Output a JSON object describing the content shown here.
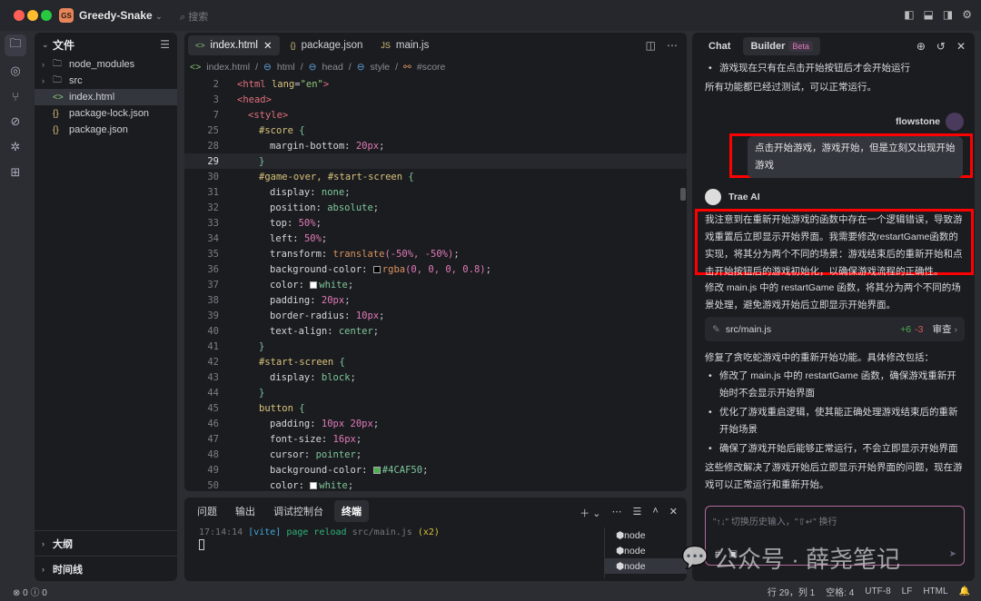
{
  "title_bar": {
    "project_initials": "GS",
    "project_name": "Greedy-Snake",
    "search_placeholder": "搜索"
  },
  "explorer": {
    "title": "文件",
    "items": [
      {
        "label": "node_modules",
        "type": "folder"
      },
      {
        "label": "src",
        "type": "folder"
      },
      {
        "label": "index.html",
        "type": "html",
        "selected": true
      },
      {
        "label": "package-lock.json",
        "type": "json"
      },
      {
        "label": "package.json",
        "type": "json"
      }
    ],
    "outline_label": "大纲",
    "timeline_label": "时间线"
  },
  "editor": {
    "tabs": [
      {
        "label": "index.html",
        "icon": "<>",
        "active": true
      },
      {
        "label": "package.json",
        "icon": "{}"
      },
      {
        "label": "main.js",
        "icon": "JS"
      }
    ],
    "breadcrumb": [
      "index.html",
      "html",
      "head",
      "style",
      "#score"
    ],
    "current_line": 29,
    "lines": [
      {
        "n": "2",
        "i": 0,
        "t": [
          [
            "tag",
            "<html "
          ],
          [
            "attr",
            "lang"
          ],
          [
            "pun",
            "="
          ],
          [
            "str",
            "\"en\""
          ],
          [
            "tag",
            ">"
          ]
        ]
      },
      {
        "n": "3",
        "i": 0,
        "t": [
          [
            "tag",
            "<head>"
          ]
        ]
      },
      {
        "n": "7",
        "i": 1,
        "t": [
          [
            "tag",
            "<style>"
          ]
        ]
      },
      {
        "n": "25",
        "i": 2,
        "t": [
          [
            "sel",
            "#score "
          ],
          [
            "brace",
            "{"
          ]
        ]
      },
      {
        "n": "28",
        "i": 3,
        "t": [
          [
            "prop",
            "margin-bottom: "
          ],
          [
            "num",
            "20px"
          ],
          [
            "pun",
            ";"
          ]
        ]
      },
      {
        "n": "29",
        "i": 2,
        "t": [
          [
            "brace",
            "}"
          ]
        ]
      },
      {
        "n": "30",
        "i": 2,
        "t": [
          [
            "sel",
            "#game-over, #start-screen "
          ],
          [
            "brace",
            "{"
          ]
        ]
      },
      {
        "n": "31",
        "i": 3,
        "t": [
          [
            "prop",
            "display: "
          ],
          [
            "val",
            "none"
          ],
          [
            "pun",
            ";"
          ]
        ]
      },
      {
        "n": "32",
        "i": 3,
        "t": [
          [
            "prop",
            "position: "
          ],
          [
            "val",
            "absolute"
          ],
          [
            "pun",
            ";"
          ]
        ]
      },
      {
        "n": "33",
        "i": 3,
        "t": [
          [
            "prop",
            "top: "
          ],
          [
            "num",
            "50%"
          ],
          [
            "pun",
            ";"
          ]
        ]
      },
      {
        "n": "34",
        "i": 3,
        "t": [
          [
            "prop",
            "left: "
          ],
          [
            "num",
            "50%"
          ],
          [
            "pun",
            ";"
          ]
        ]
      },
      {
        "n": "35",
        "i": 3,
        "t": [
          [
            "prop",
            "transform: "
          ],
          [
            "fn",
            "translate"
          ],
          [
            "num",
            "(-50%, -50%)"
          ],
          [
            "pun",
            ";"
          ]
        ]
      },
      {
        "n": "36",
        "i": 3,
        "t": [
          [
            "prop",
            "background-color: "
          ],
          [
            "sw:#000000",
            ""
          ],
          [
            "fn",
            "rgba"
          ],
          [
            "num",
            "(0, 0, 0, 0.8)"
          ],
          [
            "pun",
            ";"
          ]
        ]
      },
      {
        "n": "37",
        "i": 3,
        "t": [
          [
            "prop",
            "color: "
          ],
          [
            "sw:#ffffff",
            ""
          ],
          [
            "val",
            "white"
          ],
          [
            "pun",
            ";"
          ]
        ]
      },
      {
        "n": "38",
        "i": 3,
        "t": [
          [
            "prop",
            "padding: "
          ],
          [
            "num",
            "20px"
          ],
          [
            "pun",
            ";"
          ]
        ]
      },
      {
        "n": "39",
        "i": 3,
        "t": [
          [
            "prop",
            "border-radius: "
          ],
          [
            "num",
            "10px"
          ],
          [
            "pun",
            ";"
          ]
        ]
      },
      {
        "n": "40",
        "i": 3,
        "t": [
          [
            "prop",
            "text-align: "
          ],
          [
            "val",
            "center"
          ],
          [
            "pun",
            ";"
          ]
        ]
      },
      {
        "n": "41",
        "i": 2,
        "t": [
          [
            "brace",
            "}"
          ]
        ]
      },
      {
        "n": "42",
        "i": 2,
        "t": [
          [
            "sel",
            "#start-screen "
          ],
          [
            "brace",
            "{"
          ]
        ]
      },
      {
        "n": "43",
        "i": 3,
        "t": [
          [
            "prop",
            "display: "
          ],
          [
            "val",
            "block"
          ],
          [
            "pun",
            ";"
          ]
        ]
      },
      {
        "n": "44",
        "i": 2,
        "t": [
          [
            "brace",
            "}"
          ]
        ]
      },
      {
        "n": "45",
        "i": 2,
        "t": [
          [
            "sel",
            "button "
          ],
          [
            "brace",
            "{"
          ]
        ]
      },
      {
        "n": "46",
        "i": 3,
        "t": [
          [
            "prop",
            "padding: "
          ],
          [
            "num",
            "10px 20px"
          ],
          [
            "pun",
            ";"
          ]
        ]
      },
      {
        "n": "47",
        "i": 3,
        "t": [
          [
            "prop",
            "font-size: "
          ],
          [
            "num",
            "16px"
          ],
          [
            "pun",
            ";"
          ]
        ]
      },
      {
        "n": "48",
        "i": 3,
        "t": [
          [
            "prop",
            "cursor: "
          ],
          [
            "val",
            "pointer"
          ],
          [
            "pun",
            ";"
          ]
        ]
      },
      {
        "n": "49",
        "i": 3,
        "t": [
          [
            "prop",
            "background-color: "
          ],
          [
            "sw:#4CAF50",
            ""
          ],
          [
            "val",
            "#4CAF50"
          ],
          [
            "pun",
            ";"
          ]
        ]
      },
      {
        "n": "50",
        "i": 3,
        "t": [
          [
            "prop",
            "color: "
          ],
          [
            "sw:#ffffff",
            ""
          ],
          [
            "val",
            "white"
          ],
          [
            "pun",
            ";"
          ]
        ]
      }
    ]
  },
  "terminal": {
    "tabs": [
      "问题",
      "输出",
      "调试控制台",
      "终端"
    ],
    "active_tab": "终端",
    "output": {
      "time": "17:14:14 ",
      "tag": "[vite]",
      "msg": " page reload ",
      "file": "src/main.js ",
      "count": "(x2)"
    },
    "sessions": [
      "node",
      "node",
      "node"
    ]
  },
  "chat": {
    "tabs": {
      "chat": "Chat",
      "builder": "Builder",
      "beta": "Beta"
    },
    "prev_bullet": "游戏现在只有在点击开始按钮后才会开始运行",
    "prev_text": "所有功能都已经过测试，可以正常运行。",
    "user_name": "flowstone",
    "user_message": "点击开始游戏，游戏开始，但是立刻又出现开始游戏",
    "ai_name": "Trae AI",
    "ai_analysis": "我注意到在重新开始游戏的函数中存在一个逻辑错误，导致游戏重置后立即显示开始界面。我需要修改restartGame函数的实现，将其分为两个不同的场景：游戏结束后的重新开始和点击开始按钮后的游戏初始化，以确保游戏流程的正确性。",
    "ai_plan": "修改 main.js 中的 restartGame 函数，将其分为两个不同的场景处理，避免游戏开始后立即显示开始界面。",
    "file_change": {
      "path": "src/main.js",
      "added": "+6",
      "removed": "-3",
      "review": "审查"
    },
    "summary_intro": "修复了贪吃蛇游戏中的重新开始功能。具体修改包括：",
    "summary_items": [
      "修改了 main.js 中的 restartGame 函数，确保游戏重新开始时不会显示开始界面",
      "优化了游戏重启逻辑，使其能正确处理游戏结束后的重新开始场景",
      "确保了游戏开始后能够正常运行，不会立即显示开始界面"
    ],
    "summary_end": "这些修改解决了游戏开始后立即显示开始界面的问题，现在游戏可以正常运行和重新开始。",
    "input_placeholder": "\"↑↓\" 切换历史输入，\"⇧↵\" 换行"
  },
  "status_bar": {
    "errors": "0",
    "warnings": "0",
    "position": "行 29，列 1",
    "spaces": "空格: 4",
    "encoding": "UTF-8",
    "eol": "LF",
    "language": "HTML"
  },
  "watermark": "公众号 · 薛尧笔记",
  "colors": {
    "highlight_box": "#ff0000",
    "added": "#4caf50",
    "removed": "#e05555"
  }
}
